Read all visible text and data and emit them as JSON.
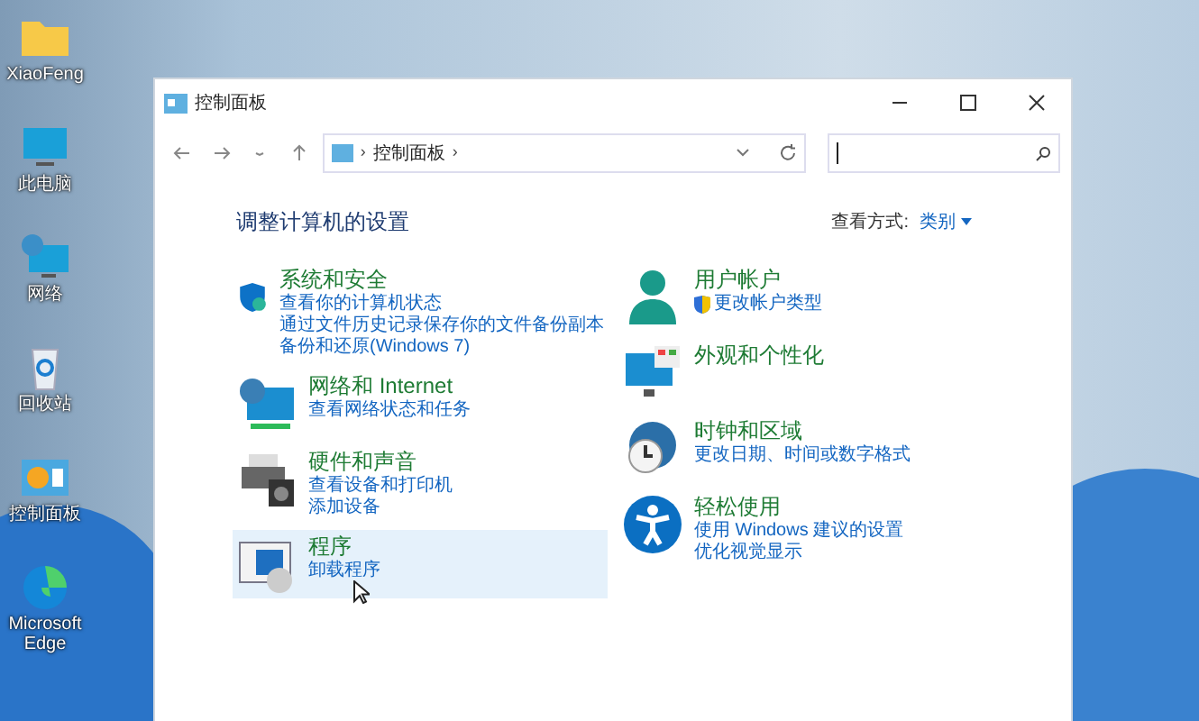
{
  "desktop_icons": [
    {
      "label": "XiaoFeng",
      "kind": "folder"
    },
    {
      "label": "此电脑",
      "kind": "pc"
    },
    {
      "label": "网络",
      "kind": "network"
    },
    {
      "label": "回收站",
      "kind": "recycle"
    },
    {
      "label": "控制面板",
      "kind": "control"
    },
    {
      "label": "Microsoft Edge",
      "kind": "edge"
    }
  ],
  "window": {
    "title": "控制面板"
  },
  "address_bar": {
    "separator": "›",
    "crumbs": [
      "控制面板"
    ]
  },
  "heading": "调整计算机的设置",
  "view_by": {
    "label": "查看方式:",
    "value": "类别"
  },
  "columns": [
    [
      {
        "title": "系统和安全",
        "kind": "security",
        "selected": false,
        "links": [
          {
            "text": "查看你的计算机状态",
            "shield": false
          },
          {
            "text": "通过文件历史记录保存你的文件备份副本",
            "shield": false
          },
          {
            "text": "备份和还原(Windows 7)",
            "shield": false
          }
        ]
      },
      {
        "title": "网络和 Internet",
        "kind": "network",
        "selected": false,
        "links": [
          {
            "text": "查看网络状态和任务",
            "shield": false
          }
        ]
      },
      {
        "title": "硬件和声音",
        "kind": "hardware",
        "selected": false,
        "links": [
          {
            "text": "查看设备和打印机",
            "shield": false
          },
          {
            "text": "添加设备",
            "shield": false
          }
        ]
      },
      {
        "title": "程序",
        "kind": "programs",
        "selected": true,
        "links": [
          {
            "text": "卸载程序",
            "shield": false
          }
        ]
      }
    ],
    [
      {
        "title": "用户帐户",
        "kind": "user",
        "selected": false,
        "links": [
          {
            "text": "更改帐户类型",
            "shield": true
          }
        ]
      },
      {
        "title": "外观和个性化",
        "kind": "appearance",
        "selected": false
      },
      {
        "title": "时钟和区域",
        "kind": "clock",
        "selected": false,
        "links": [
          {
            "text": "更改日期、时间或数字格式",
            "shield": false
          }
        ]
      },
      {
        "title": "轻松使用",
        "kind": "access",
        "selected": false,
        "links": [
          {
            "text": "使用 Windows 建议的设置",
            "shield": false
          },
          {
            "text": "优化视觉显示",
            "shield": false
          }
        ]
      }
    ]
  ]
}
